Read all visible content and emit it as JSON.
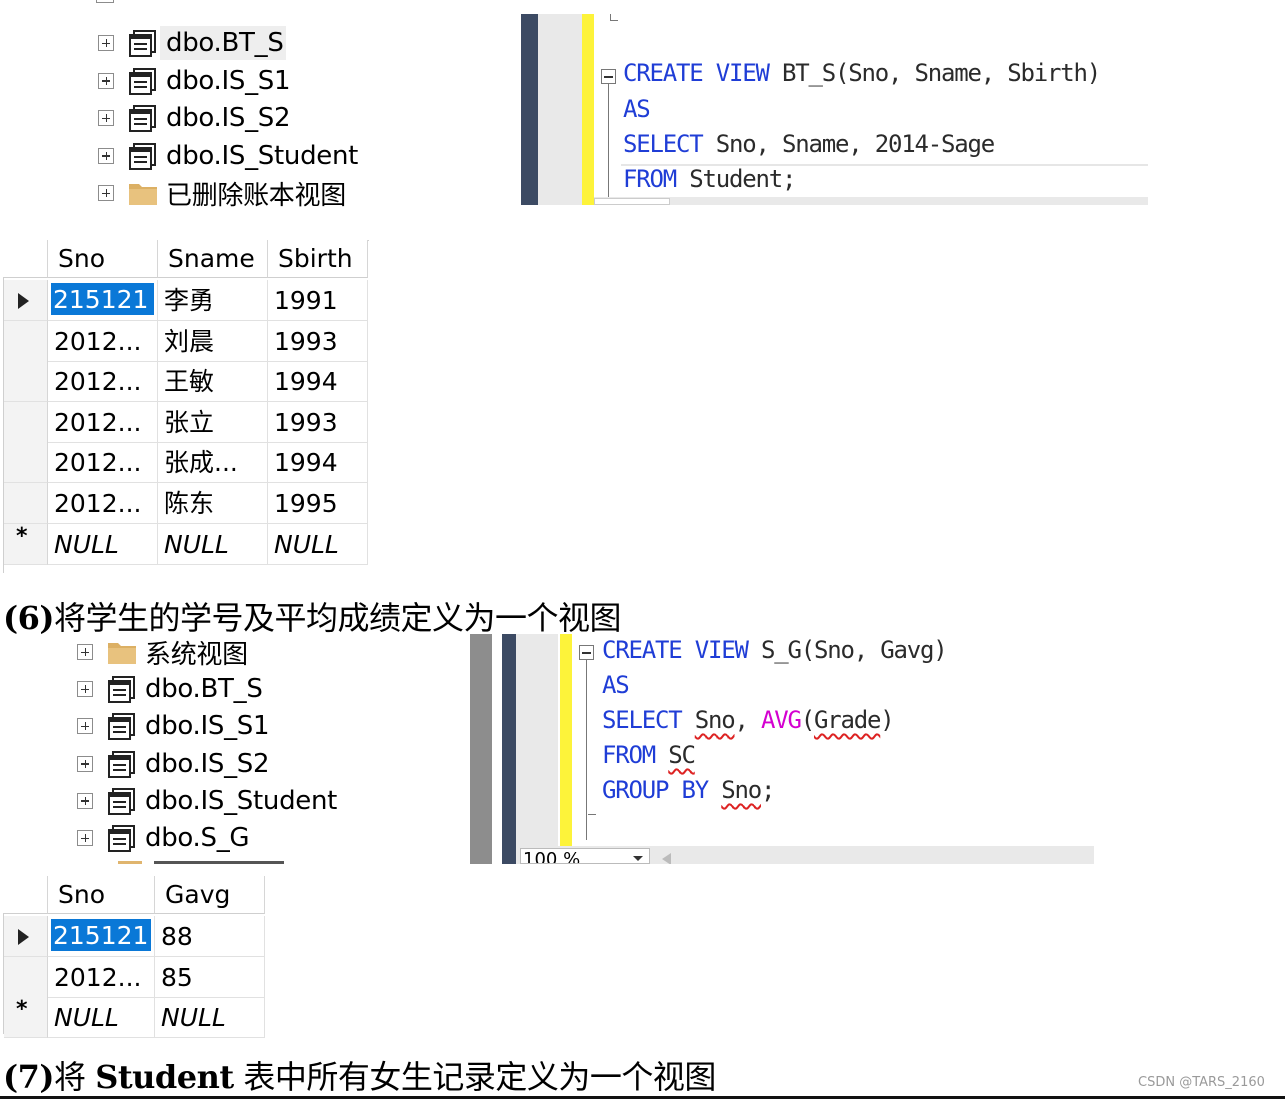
{
  "tree1": {
    "items": [
      {
        "label": "dbo.BT_S",
        "icon": "view-icon"
      },
      {
        "label": "dbo.IS_S1",
        "icon": "view-icon"
      },
      {
        "label": "dbo.IS_S2",
        "icon": "view-icon"
      },
      {
        "label": "dbo.IS_Student",
        "icon": "view-icon"
      },
      {
        "label": "已删除账本视图",
        "icon": "folder-icon"
      }
    ]
  },
  "editor1": {
    "lines": [
      {
        "kw1": "CREATE",
        "kw2": "VIEW",
        "rest": " BT_S(Sno, Sname, Sbirth)"
      },
      {
        "kw1": "AS"
      },
      {
        "kw1": "SELECT",
        "rest": " Sno, Sname, 2014-Sage"
      },
      {
        "kw1": "FROM",
        "rest": " Student;"
      }
    ]
  },
  "grid1": {
    "columns": [
      "Sno",
      "Sname",
      "Sbirth"
    ],
    "rows": [
      [
        "215121",
        "李勇",
        "1991"
      ],
      [
        "2012...",
        "刘晨",
        "1993"
      ],
      [
        "2012...",
        "王敏",
        "1994"
      ],
      [
        "2012...",
        "张立",
        "1993"
      ],
      [
        "2012...",
        "张成...",
        "1994"
      ],
      [
        "2012...",
        "陈东",
        "1995"
      ]
    ],
    "new_row": [
      "NULL",
      "NULL",
      "NULL"
    ],
    "new_row_marker": "*"
  },
  "heading6": {
    "num": "(6)",
    "text": "将学生的学号及平均成绩定义为一个视图"
  },
  "tree2": {
    "items": [
      {
        "label": "系统视图",
        "icon": "folder-icon"
      },
      {
        "label": "dbo.BT_S",
        "icon": "view-icon"
      },
      {
        "label": "dbo.IS_S1",
        "icon": "view-icon"
      },
      {
        "label": "dbo.IS_S2",
        "icon": "view-icon"
      },
      {
        "label": "dbo.IS_Student",
        "icon": "view-icon"
      },
      {
        "label": "dbo.S_G",
        "icon": "view-icon"
      }
    ]
  },
  "editor2": {
    "l1_kw1": "CREATE",
    "l1_kw2": "VIEW",
    "l1_rest": " S_G(Sno, Gavg)",
    "l2_kw": "AS",
    "l3_kw": "SELECT",
    "l3_sno": "Sno",
    "l3_comma": ", ",
    "l3_fn": "AVG",
    "l3_open": "(",
    "l3_arg": "Grade",
    "l3_close": ")",
    "l4_kw": "FROM",
    "l4_tbl": "SC",
    "l5_kw1": "GROUP",
    "l5_kw2": "BY",
    "l5_col": "Sno",
    "l5_end": ";",
    "zoom": "100 %"
  },
  "grid2": {
    "columns": [
      "Sno",
      "Gavg"
    ],
    "rows": [
      [
        "215121",
        "88"
      ],
      [
        "2012...",
        "85"
      ]
    ],
    "new_row": [
      "NULL",
      "NULL"
    ],
    "new_row_marker": "*"
  },
  "heading7": {
    "num": "(7)",
    "text_a": "将 ",
    "text_b": "Student",
    "text_c": " 表中所有女生记录定义为一个视图"
  },
  "watermark": "CSDN @TARS_2160",
  "colors": {
    "keyword": "#1f3dd6",
    "function": "#d400d0",
    "selection": "#0a78d7",
    "gutter": "#3c4a63",
    "change_bar": "#fdf33a"
  }
}
